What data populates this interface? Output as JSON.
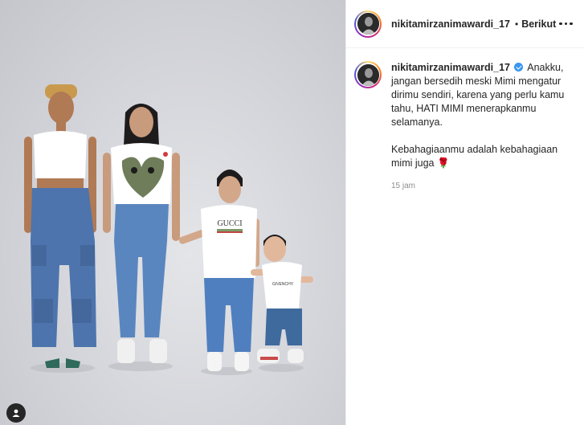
{
  "post": {
    "author": {
      "username": "nikitamirzanimawardi_17",
      "verified": true
    },
    "header": {
      "separator": "•",
      "follow_label": "Berikut"
    },
    "caption": {
      "paragraph1": "Anakku, jangan bersedih meski Mimi mengatur dirimu sendiri, karena yang perlu kamu tahu, HATI MIMI menerapkanmu selamanya.",
      "paragraph2": "Kebahagiaanmu adalah kebahagiaan mimi juga",
      "emoji": "🌹"
    },
    "timestamp": "15 jam",
    "shirt_prints": {
      "boy": "GUCCI",
      "toddler": "GIVENCHY"
    }
  },
  "icons": {
    "more": "more-options-icon",
    "user_tag": "user-tag-icon",
    "verified": "verified-badge-icon"
  },
  "colors": {
    "verified_blue": "#3897f0",
    "text_primary": "#262626",
    "text_secondary": "#8e8e8e"
  }
}
